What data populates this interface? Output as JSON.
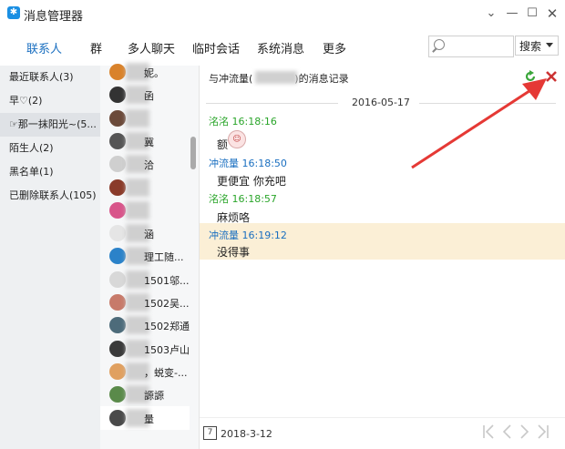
{
  "window": {
    "title": "消息管理器",
    "app_icon_glyph": "✱",
    "controls": [
      "chevron-down-icon",
      "minimize-icon",
      "maximize-icon",
      "close-icon"
    ]
  },
  "nav": {
    "tabs": [
      {
        "label": "联系人",
        "active": true
      },
      {
        "label": "群"
      },
      {
        "label": "多人聊天"
      },
      {
        "label": "临时会话"
      },
      {
        "label": "系统消息"
      },
      {
        "label": "更多"
      }
    ],
    "search_placeholder": "",
    "search_button": "搜索"
  },
  "categories": [
    {
      "label": "最近联系人(3)"
    },
    {
      "label": "早♡(2)"
    },
    {
      "label": "☞那一抹阳光~(5..."
    },
    {
      "label": "陌生人(2)"
    },
    {
      "label": "黑名单(1)"
    },
    {
      "label": "已删除联系人(105)"
    }
  ],
  "contacts": [
    {
      "name": "妮。",
      "avatar_color": "#d9822b"
    },
    {
      "name": "函",
      "avatar_color": "#333333"
    },
    {
      "name": "",
      "avatar_color": "#6b4a3a"
    },
    {
      "name": "冀",
      "avatar_color": "#555555"
    },
    {
      "name": "洽",
      "avatar_color": "#cfcfcf"
    },
    {
      "name": "",
      "avatar_color": "#8a3b2a"
    },
    {
      "name": "",
      "avatar_color": "#d8558a"
    },
    {
      "name": "涵",
      "avatar_color": "#e5e5e5"
    },
    {
      "name": "理工随...",
      "avatar_color": "#2b82c9"
    },
    {
      "name": "1501邬...",
      "avatar_color": "#d8d8d8"
    },
    {
      "name": "1502吴...",
      "avatar_color": "#c77a6a"
    },
    {
      "name": "1502郑通",
      "avatar_color": "#4d6b7a"
    },
    {
      "name": "1503卢山",
      "avatar_color": "#3a3a3a"
    },
    {
      "name": "，蜕变-...",
      "avatar_color": "#e0a060"
    },
    {
      "name": "謜謜",
      "avatar_color": "#5a8a4a"
    },
    {
      "name": "量",
      "avatar_color": "#4a4a4a",
      "selected": true
    }
  ],
  "messages": {
    "header_prefix": "与冲流量(",
    "header_suffix": ")的消息记录",
    "date": "2016-05-17",
    "items": [
      {
        "sender": "洺洺 16:18:16",
        "color": "green",
        "text": "额"
      },
      {
        "sender": "冲流量 16:18:50",
        "color": "blue",
        "text": "更便宜      你充吧"
      },
      {
        "sender": "洺洺 16:18:57",
        "color": "green",
        "text": "麻烦咯"
      },
      {
        "sender": "冲流量 16:19:12",
        "color": "blue",
        "text": "没得事",
        "highlight": true
      }
    ],
    "emoji_glyph": "☺"
  },
  "footer": {
    "calendar_glyph": "7",
    "date": "2018-3-12"
  },
  "colors": {
    "accent_blue": "#1a6fc0",
    "sender_green": "#2aa52a",
    "highlight_bg": "#fbefd6",
    "annotation_red": "#e53935"
  }
}
